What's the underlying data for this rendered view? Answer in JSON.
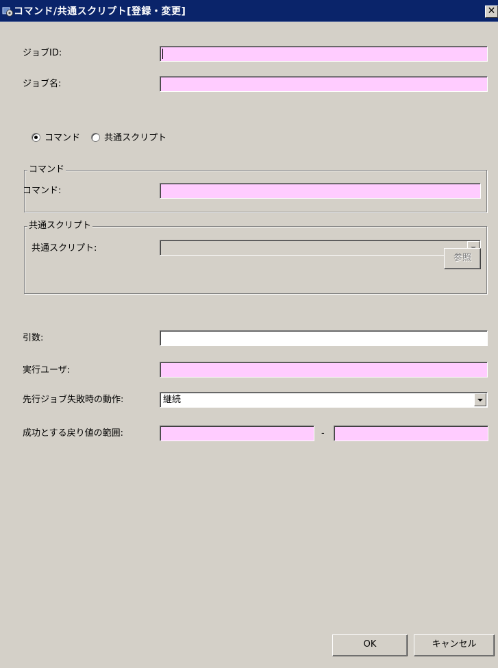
{
  "window": {
    "title": "コマンド/共通スクリプト[登録・変更]",
    "close": "✕"
  },
  "job_id": {
    "label": "ジョブID:",
    "value": ""
  },
  "job_name": {
    "label": "ジョブ名:",
    "value": ""
  },
  "type_selector": {
    "options": [
      "コマンド",
      "共通スクリプト"
    ],
    "selected": "コマンド"
  },
  "command_group": {
    "legend": "コマンド",
    "command_label": "コマンド:",
    "command_value": ""
  },
  "script_group": {
    "legend": "共通スクリプト",
    "script_label": "共通スクリプト:",
    "script_value": "",
    "browse_label": "参照"
  },
  "args": {
    "label": "引数:",
    "value": ""
  },
  "exec_user": {
    "label": "実行ユーザ:",
    "value": ""
  },
  "on_prev_fail": {
    "label": "先行ジョブ失敗時の動作:",
    "value": "継続"
  },
  "success_range": {
    "label": "成功とする戻り値の範囲:",
    "separator": "-",
    "from": "",
    "to": ""
  },
  "buttons": {
    "ok": "OK",
    "cancel": "キャンセル"
  },
  "colors": {
    "required_field": "#ffccff",
    "titlebar": "#0a246a",
    "dialog": "#d4d0c8"
  }
}
